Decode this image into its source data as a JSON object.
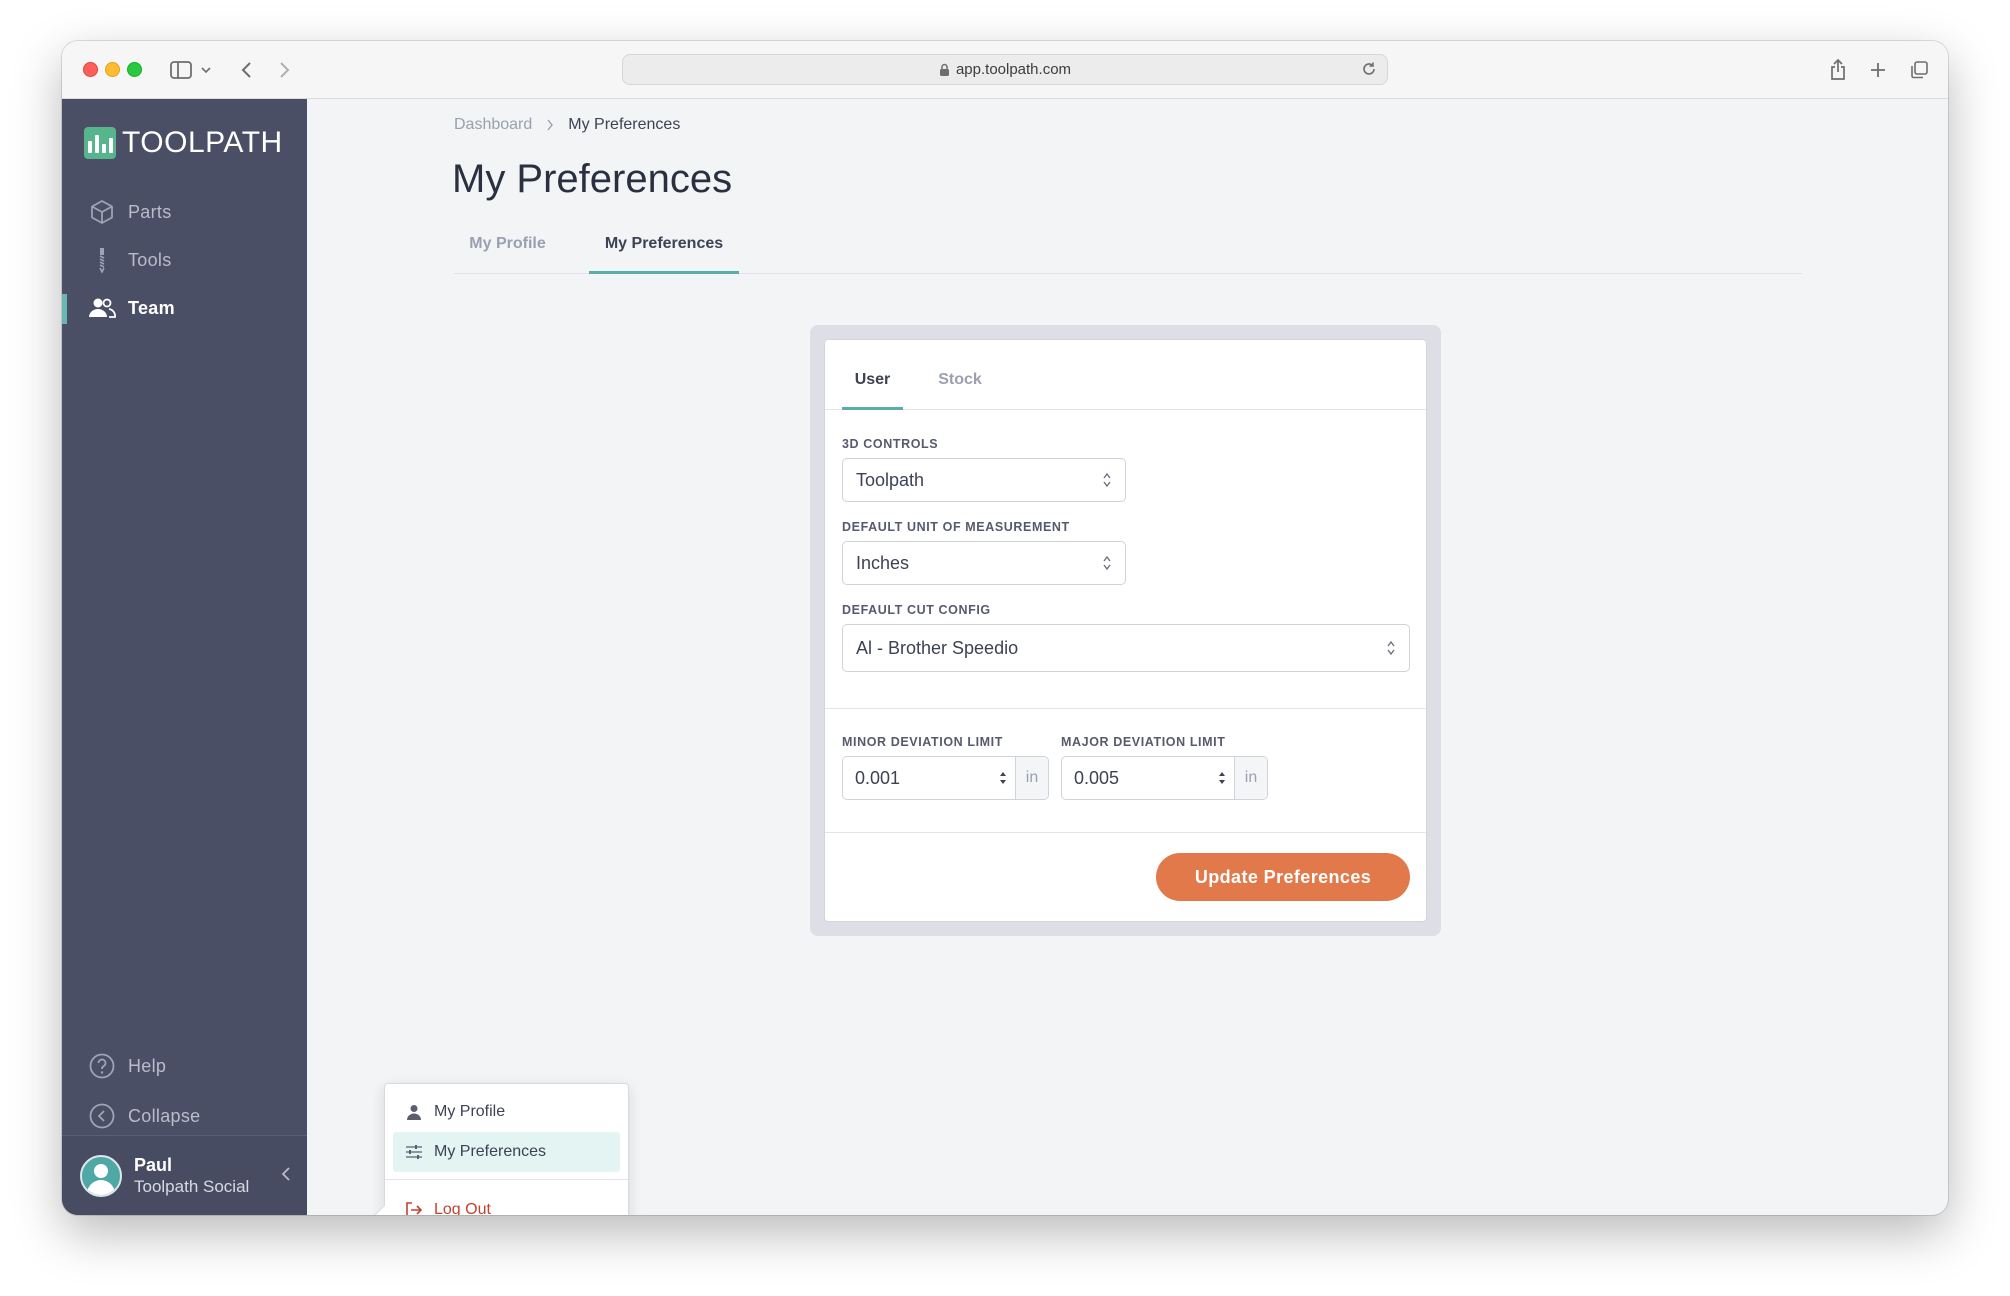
{
  "browser": {
    "url": "app.toolpath.com"
  },
  "sidebar": {
    "logo_text": "TOOLPATH",
    "nav": [
      {
        "label": "Parts",
        "icon": "cube-icon"
      },
      {
        "label": "Tools",
        "icon": "drill-bit-icon"
      },
      {
        "label": "Team",
        "icon": "team-icon",
        "active": true
      }
    ],
    "footer": [
      {
        "label": "Help",
        "icon": "help-circle-icon"
      },
      {
        "label": "Collapse",
        "icon": "collapse-circle-icon"
      }
    ],
    "user": {
      "name": "Paul",
      "org": "Toolpath Social"
    }
  },
  "main": {
    "breadcrumb": [
      "Dashboard",
      "My Preferences"
    ],
    "title": "My Preferences",
    "tabs": [
      {
        "label": "My Profile",
        "active": false
      },
      {
        "label": "My Preferences",
        "active": true
      }
    ]
  },
  "card": {
    "tabs": [
      {
        "label": "User",
        "active": true
      },
      {
        "label": "Stock",
        "active": false
      }
    ],
    "fields": {
      "controls": {
        "label": "3D Controls",
        "value": "Toolpath"
      },
      "unit": {
        "label": "Default Unit of Measurement",
        "value": "Inches"
      },
      "cut_config": {
        "label": "Default Cut Config",
        "value": "Al - Brother Speedio"
      },
      "minor_deviation": {
        "label": "Minor Deviation Limit",
        "value": "0.001",
        "unit": "in"
      },
      "major_deviation": {
        "label": "Major Deviation Limit",
        "value": "0.005",
        "unit": "in"
      }
    },
    "submit_label": "Update Preferences"
  },
  "user_menu": {
    "items": [
      {
        "label": "My Profile",
        "icon": "person-icon"
      },
      {
        "label": "My Preferences",
        "icon": "sliders-icon",
        "highlighted": true
      },
      {
        "label": "Log Out",
        "icon": "logout-icon"
      }
    ]
  },
  "colors": {
    "sidebar": "#4b4f66",
    "accent": "#5aaea9",
    "primary_button": "#e2794b",
    "logout": "#c0432e"
  }
}
